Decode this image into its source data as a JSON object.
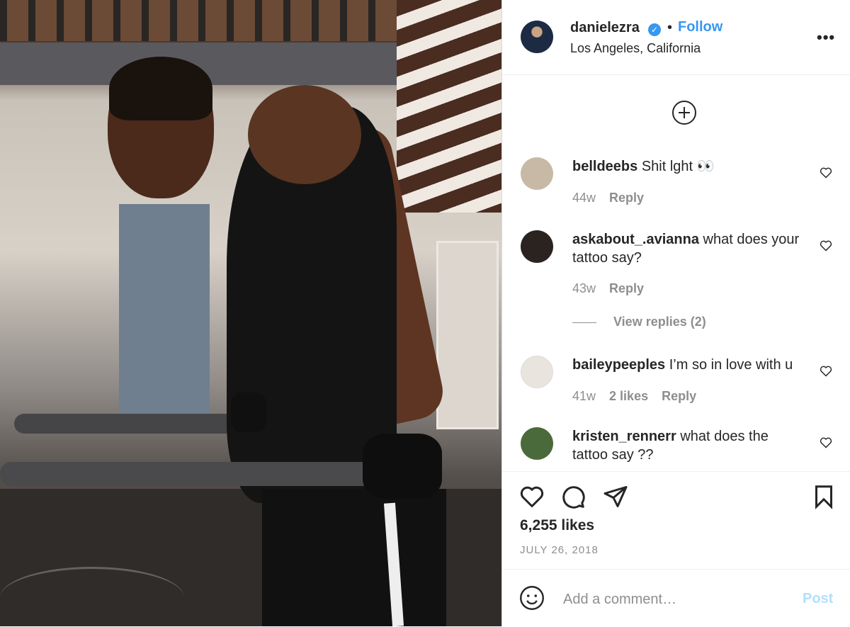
{
  "header": {
    "username": "danielezra",
    "verified_mark": "✓",
    "separator": "•",
    "follow_label": "Follow",
    "location": "Los Angeles, California",
    "more_label": "•••"
  },
  "comments": [
    {
      "username": "belldeebs",
      "text": "Shit lght 👀",
      "age": "44w",
      "likes": "",
      "reply_label": "Reply",
      "avatar_color": "#c8b9a6"
    },
    {
      "username": "askabout_.avianna",
      "text": "what does your tattoo say?",
      "age": "43w",
      "likes": "",
      "reply_label": "Reply",
      "view_replies": "View replies (2)",
      "avatar_color": "#2a2320"
    },
    {
      "username": "baileypeeples",
      "text": "I’m so in love with u",
      "age": "41w",
      "likes": "2 likes",
      "reply_label": "Reply",
      "avatar_color": "#e9e4de"
    },
    {
      "username": "kristen_rennerr",
      "text": "what does the tattoo say ??",
      "age": "",
      "likes": "",
      "reply_label": "",
      "avatar_color": "#4b6a3c"
    }
  ],
  "post": {
    "likes": "6,255 likes",
    "date": "JULY 26, 2018"
  },
  "add_comment": {
    "placeholder": "Add a comment…",
    "post_label": "Post"
  },
  "colors": {
    "accent": "#3897f0",
    "post_disabled": "#b2dffc",
    "muted": "#8e8e8e",
    "text": "#262626"
  }
}
